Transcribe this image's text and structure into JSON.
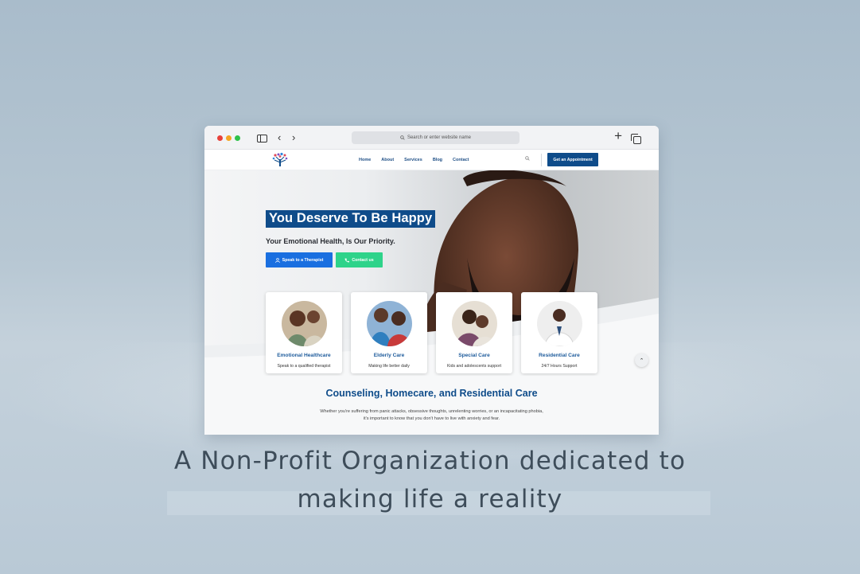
{
  "browser": {
    "url_placeholder": "Search or enter website name",
    "icons": [
      "sidebar-icon",
      "back-icon",
      "forward-icon",
      "search-icon",
      "plus-icon",
      "tabs-icon"
    ]
  },
  "site": {
    "nav": {
      "links": [
        "Home",
        "About",
        "Services",
        "Blog",
        "Contact"
      ],
      "cta_label": "Get an Appointment"
    },
    "hero": {
      "headline": "You Deserve To Be Happy",
      "subheadline": "Your Emotional Health, Is Our Priority.",
      "primary_button": "Speak to a Therapist",
      "secondary_button": "Contact us"
    },
    "cards": [
      {
        "title": "Emotional Healthcare",
        "desc": "Speak to a qualified therapist"
      },
      {
        "title": "Elderly Care",
        "desc": "Making life better daily"
      },
      {
        "title": "Special Care",
        "desc": "Kids and adolescents support"
      },
      {
        "title": "Residential Care",
        "desc": "24/7 Hours Support"
      }
    ],
    "section": {
      "title": "Counseling, Homecare, and Residential Care",
      "body_line1": "Whether you're suffering from panic attacks, obsessive thoughts, unrelenting worries, or an incapacitating phobia,",
      "body_line2": "it's important to know that you don't have to live with anxiety and fear."
    }
  },
  "tagline": {
    "line1": "A Non-Profit Organization dedicated to",
    "line2": "making life a reality"
  },
  "colors": {
    "brand_blue": "#0f4c8a",
    "button_blue": "#1a6fe0",
    "button_green": "#2ed38a",
    "card_title": "#1f5c9c"
  }
}
